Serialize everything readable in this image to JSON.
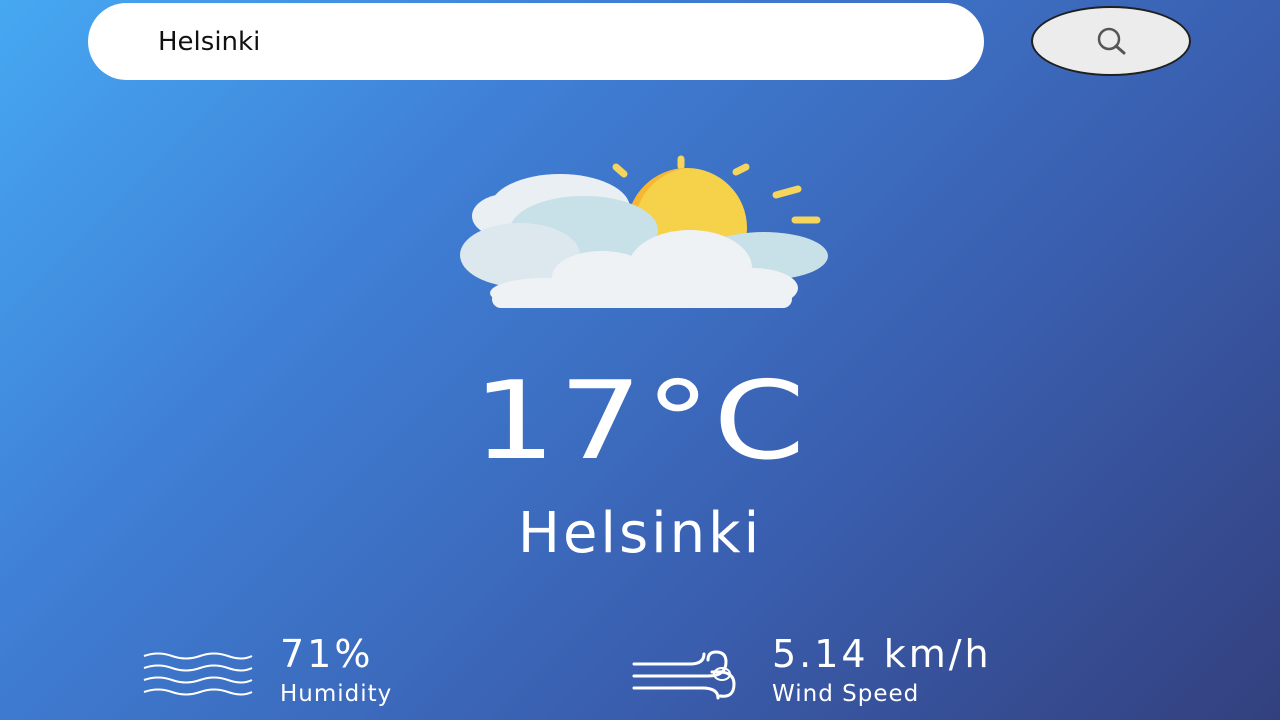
{
  "search": {
    "value": "Helsinki",
    "button_icon": "search-icon"
  },
  "weather": {
    "icon": "partly-cloudy-icon",
    "temperature": "17°C",
    "city": "Helsinki"
  },
  "details": {
    "humidity": {
      "icon": "humidity-waves-icon",
      "value": "71%",
      "label": "Humidity"
    },
    "wind": {
      "icon": "wind-icon",
      "value": "5.14 km/h",
      "label": "Wind Speed"
    }
  },
  "colors": {
    "background_top": "#46a8f2",
    "background_bottom": "#33407e",
    "sun": "#f7b733",
    "cloud": "#eef2f5"
  }
}
